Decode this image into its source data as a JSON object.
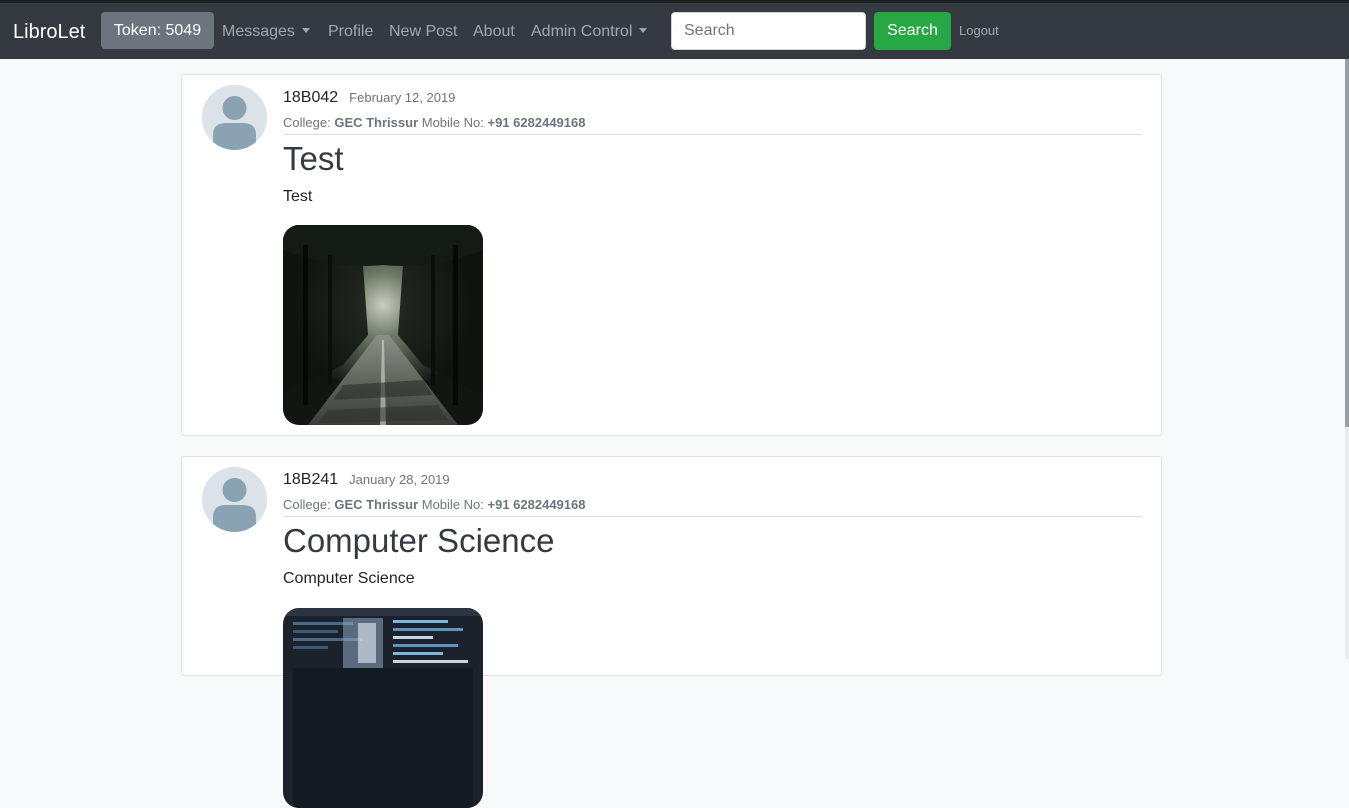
{
  "navbar": {
    "brand": "LibroLet",
    "token_label": "Token: 5049",
    "links": {
      "messages": "Messages",
      "profile": "Profile",
      "new_post": "New Post",
      "about": "About",
      "admin_control": "Admin Control"
    },
    "search_placeholder": "Search",
    "search_button": "Search",
    "logout": "Logout"
  },
  "posts": [
    {
      "author": "18B042",
      "date": "February 12, 2019",
      "college_label": "College:",
      "college": "GEC Thrissur",
      "mobile_label": "Mobile No:",
      "mobile": "+91 6282449168",
      "title": "Test",
      "text": "Test",
      "image_icon": "forest-road-photo"
    },
    {
      "author": "18B241",
      "date": "January 28, 2019",
      "college_label": "College:",
      "college": "GEC Thrissur",
      "mobile_label": "Mobile No:",
      "mobile": "+91 6282449168",
      "title": "Computer Science",
      "text": "Computer Science",
      "image_icon": "code-screen-photo"
    }
  ],
  "colors": {
    "navbar_bg": "#343a40",
    "token_bg": "#6c757d",
    "search_button_bg": "#28a745",
    "page_bg": "#f8f9fa",
    "avatar_bg": "#dbe2e8",
    "avatar_figure": "#8aa3b3"
  }
}
